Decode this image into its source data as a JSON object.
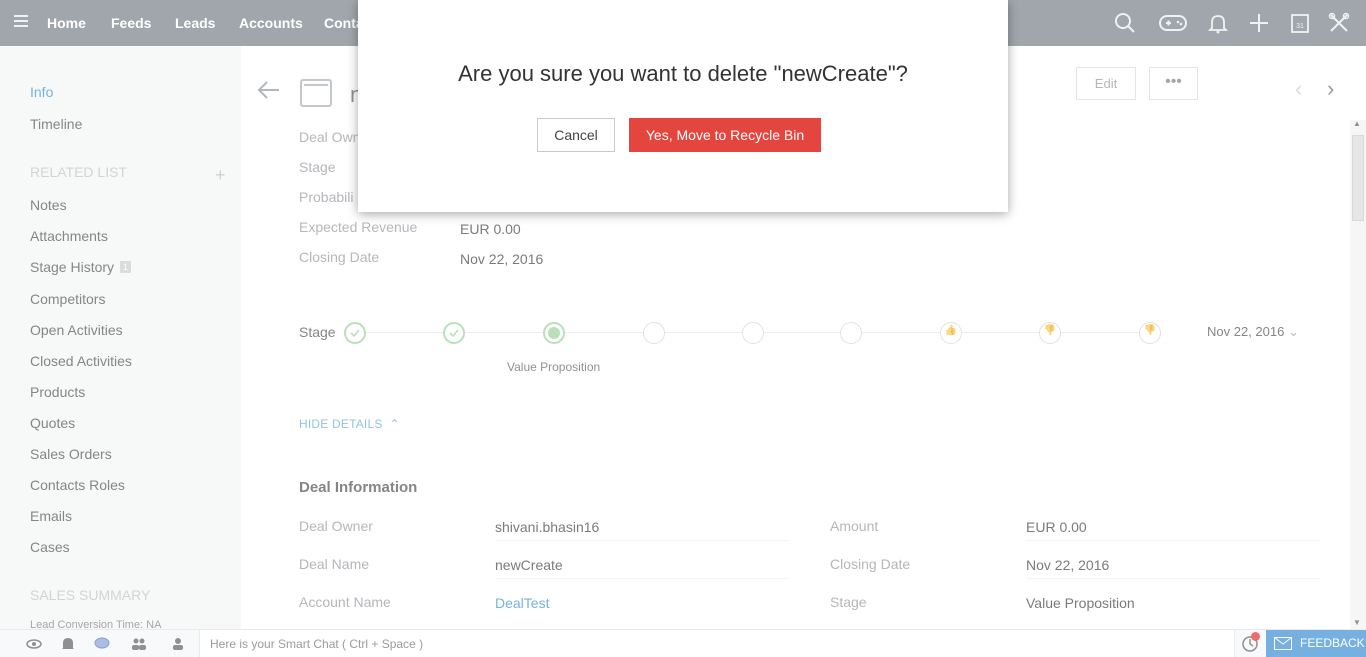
{
  "topnav": {
    "tabs": [
      "Home",
      "Feeds",
      "Leads",
      "Accounts",
      "Conta"
    ],
    "icons": [
      "search-icon",
      "gamepad-icon",
      "bell-icon",
      "plus-icon",
      "calendar-icon",
      "tools-icon"
    ],
    "calendar_day": "31"
  },
  "sidebar": {
    "info": "Info",
    "timeline": "Timeline",
    "related_list_heading": "RELATED LIST",
    "plus": "+",
    "items": [
      {
        "label": "Notes"
      },
      {
        "label": "Attachments"
      },
      {
        "label": "Stage History",
        "badge": "1"
      },
      {
        "label": "Competitors"
      },
      {
        "label": "Open Activities"
      },
      {
        "label": "Closed Activities"
      },
      {
        "label": "Products"
      },
      {
        "label": "Quotes"
      },
      {
        "label": "Sales Orders"
      },
      {
        "label": "Contacts Roles"
      },
      {
        "label": "Emails"
      },
      {
        "label": "Cases"
      }
    ],
    "sales_summary_heading": "SALES SUMMARY",
    "lead_conversion": "Lead Conversion Time: NA"
  },
  "record": {
    "title_partial": "n",
    "edit_label": "Edit",
    "more_label": "•••",
    "summary": [
      {
        "label": "Deal Own",
        "value": ""
      },
      {
        "label": "Stage",
        "value": ""
      },
      {
        "label": "Probabili",
        "value": ""
      },
      {
        "label": "Expected Revenue",
        "value": "EUR 0.00"
      },
      {
        "label": "Closing Date",
        "value": "Nov 22, 2016"
      }
    ],
    "stage_label": "Stage",
    "stage_current": "Value Proposition",
    "stage_date": "Nov 22, 2016",
    "hide_details": "HIDE DETAILS",
    "section_title": "Deal Information",
    "details_left": [
      {
        "label": "Deal Owner",
        "value": "shivani.bhasin16"
      },
      {
        "label": "Deal Name",
        "value": "newCreate"
      },
      {
        "label": "Account Name",
        "value": "DealTest"
      }
    ],
    "details_right": [
      {
        "label": "Amount",
        "value": "EUR 0.00"
      },
      {
        "label": "Closing Date",
        "value": "Nov 22, 2016"
      },
      {
        "label": "Stage",
        "value": "Value Proposition"
      }
    ]
  },
  "modal": {
    "message": "Are you sure you want to delete \"newCreate\"?",
    "cancel": "Cancel",
    "confirm": "Yes, Move to Recycle Bin",
    "confirm_color": "#e5453f"
  },
  "bottombar": {
    "smart_chat_placeholder": "Here is your Smart Chat ( Ctrl + Space )",
    "feedback": "FEEDBACK"
  },
  "colors": {
    "topnav_bg": "#6f7780",
    "accent": "#2b8acb",
    "stage_done": "#95cf95"
  }
}
